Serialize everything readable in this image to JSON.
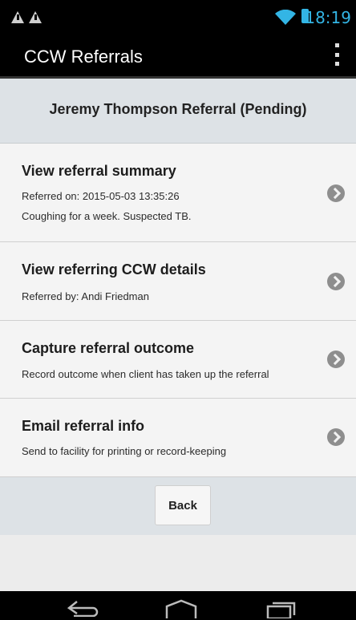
{
  "status_bar": {
    "time": "18:19",
    "icons": [
      "warning-icon",
      "warning-icon",
      "wifi-icon",
      "battery-icon"
    ],
    "accent": "#33b5e5"
  },
  "action_bar": {
    "title": "CCW Referrals",
    "menu_icon": "overflow-menu-icon"
  },
  "header": {
    "title": "Jeremy Thompson Referral  (Pending)"
  },
  "items": [
    {
      "title": "View referral summary",
      "lines": [
        "Referred on: 2015-05-03 13:35:26",
        "Coughing for a week. Suspected TB."
      ],
      "icon": "chevron-right-icon"
    },
    {
      "title": "View referring CCW details",
      "lines": [
        "Referred by: Andi Friedman"
      ],
      "icon": "chevron-right-icon"
    },
    {
      "title": "Capture referral outcome",
      "lines": [
        "Record outcome when client has taken up the referral"
      ],
      "icon": "chevron-right-icon"
    },
    {
      "title": "Email referral info",
      "lines": [
        "Send to facility for printing or record-keeping"
      ],
      "icon": "chevron-right-icon"
    }
  ],
  "footer": {
    "back_label": "Back"
  },
  "nav_bar": {
    "icons": [
      "back-nav-icon",
      "home-nav-icon",
      "recents-nav-icon"
    ]
  }
}
